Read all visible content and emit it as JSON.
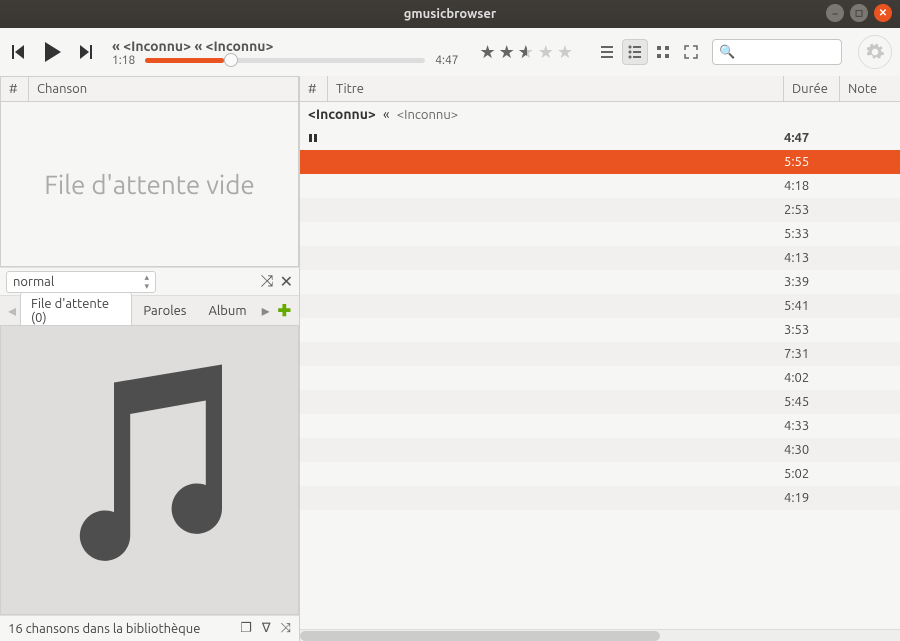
{
  "window": {
    "title": "gmusicbrowser"
  },
  "player": {
    "track_line": "«  <Inconnu>  «  <Inconnu>",
    "elapsed": "1:18",
    "total": "4:47"
  },
  "search": {
    "placeholder": ""
  },
  "left": {
    "header_num": "#",
    "header_title": "Chanson",
    "empty_text": "File d'attente vide",
    "mode": "normal",
    "tabs": {
      "queue": "File d'attente (0)",
      "lyrics": "Paroles",
      "album": "Album"
    }
  },
  "right": {
    "header_num": "#",
    "header_title": "Titre",
    "header_dur": "Durée",
    "header_note": "Note",
    "group_artist": "<Inconnu>",
    "group_sep": "«",
    "group_album": "<Inconnu>",
    "tracks": [
      {
        "dur": "4:47",
        "playing": true
      },
      {
        "dur": "5:55",
        "selected": true
      },
      {
        "dur": "4:18"
      },
      {
        "dur": "2:53"
      },
      {
        "dur": "5:33"
      },
      {
        "dur": "4:13"
      },
      {
        "dur": "3:39"
      },
      {
        "dur": "5:41"
      },
      {
        "dur": "3:53"
      },
      {
        "dur": "7:31"
      },
      {
        "dur": "4:02"
      },
      {
        "dur": "5:45"
      },
      {
        "dur": "4:33"
      },
      {
        "dur": "4:30"
      },
      {
        "dur": "5:02"
      },
      {
        "dur": "4:19"
      }
    ]
  },
  "status": {
    "text": "16 chansons dans la bibliothèque"
  }
}
